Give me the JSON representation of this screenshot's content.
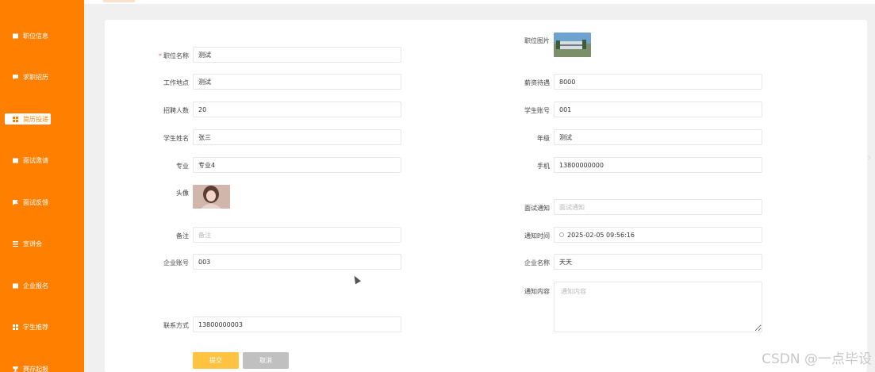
{
  "sidebar": {
    "items": [
      {
        "label": "职位信息",
        "icon": "document-icon"
      },
      {
        "label": "求职招历",
        "icon": "chat-icon"
      },
      {
        "label": "简历投递",
        "icon": "grid-icon",
        "active": true
      },
      {
        "label": "面试邀请",
        "icon": "document-icon"
      },
      {
        "label": "面试反馈",
        "icon": "flag-icon"
      },
      {
        "label": "宣讲会",
        "icon": "list-icon"
      },
      {
        "label": "企业报名",
        "icon": "clipboard-icon"
      },
      {
        "label": "学生推荐",
        "icon": "grid-icon"
      },
      {
        "label": "赛存起报",
        "icon": "trophy-icon"
      }
    ]
  },
  "form": {
    "left": {
      "position_name": {
        "label": "职位名称",
        "value": "测试",
        "required": true
      },
      "work_location": {
        "label": "工作地点",
        "value": "测试"
      },
      "hiring_count": {
        "label": "招聘人数",
        "value": "20"
      },
      "student_name": {
        "label": "学生姓名",
        "value": "张三"
      },
      "major": {
        "label": "专业",
        "value": "专业4"
      },
      "avatar": {
        "label": "头像"
      },
      "remark": {
        "label": "备注",
        "placeholder": "备注"
      },
      "company_account": {
        "label": "企业账号",
        "value": "003"
      },
      "contact": {
        "label": "联系方式",
        "value": "13800000003"
      }
    },
    "right": {
      "position_image": {
        "label": "职位图片"
      },
      "salary": {
        "label": "薪资待遇",
        "value": "8000"
      },
      "student_account": {
        "label": "学生账号",
        "value": "001"
      },
      "grade": {
        "label": "年级",
        "value": "测试"
      },
      "phone": {
        "label": "手机",
        "value": "13800000000"
      },
      "interview_notice": {
        "label": "面试通知",
        "placeholder": "面试通知"
      },
      "notice_time": {
        "label": "通知时间",
        "value": "2025-02-05 09:56:16"
      },
      "company_name": {
        "label": "企业名称",
        "value": "天天"
      },
      "notice_content": {
        "label": "通知内容",
        "placeholder": "通知内容"
      }
    },
    "buttons": {
      "submit": "提交",
      "cancel": "取消"
    }
  },
  "watermark": "CSDN @一点毕设"
}
